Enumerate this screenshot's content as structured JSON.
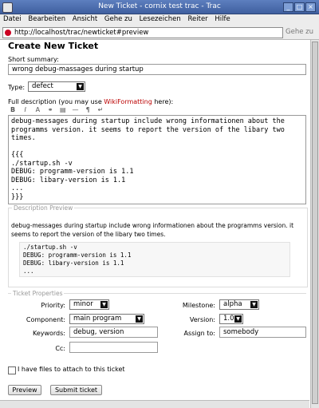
{
  "window": {
    "title": "New Ticket - cornix test trac - Trac"
  },
  "menu": [
    "Datei",
    "Bearbeiten",
    "Ansicht",
    "Gehe zu",
    "Lesezeichen",
    "Reiter",
    "Hilfe"
  ],
  "address": {
    "url": "http://localhost/trac/newticket#preview",
    "go_label": "Gehe zu"
  },
  "form": {
    "heading": "Create New Ticket",
    "summary_label": "Short summary:",
    "summary_value": "wrong debug-massages during startup",
    "type_label": "Type:",
    "type_value": "defect",
    "description_label_prefix": "Full description (you may use ",
    "description_label_link": "WikiFormatting",
    "description_label_suffix": " here):",
    "description_lines": [
      "debug-messages during startup include wrong informationen about the",
      "programms version. it seems to report the version of the libary two",
      "times.",
      "",
      "{{{",
      "./startup.sh -v",
      "DEBUG: programm-version is 1.1",
      "DEBUG: libary-version is 1.1",
      "...",
      "}}}"
    ],
    "toolbar_icons": [
      "bold-icon",
      "italic-icon",
      "heading-icon",
      "link-icon",
      "code-icon",
      "hr-icon",
      "paragraph-icon",
      "linebreak-icon"
    ]
  },
  "preview": {
    "legend": "Description Preview",
    "text": "debug-messages during startup include wrong informationen about the programms version. it seems to report the version of the libary two times.",
    "code_lines": [
      "./startup.sh -v",
      "DEBUG: programm-version is 1.1",
      "DEBUG: libary-version is 1.1",
      "..."
    ]
  },
  "properties": {
    "legend": "Ticket Properties",
    "priority_label": "Priority:",
    "priority_value": "minor",
    "component_label": "Component:",
    "component_value": "main program",
    "keywords_label": "Keywords:",
    "keywords_value": "debug, version",
    "cc_label": "Cc:",
    "cc_value": "",
    "milestone_label": "Milestone:",
    "milestone_value": "alpha",
    "version_label": "Version:",
    "version_value": "1.0",
    "assign_label": "Assign to:",
    "assign_value": "somebody"
  },
  "attach_label": "I have files to attach to this ticket",
  "buttons": {
    "preview": "Preview",
    "submit": "Submit ticket"
  },
  "colors": {
    "link": "#bb0000",
    "titlebar": "#4e6fb0"
  }
}
